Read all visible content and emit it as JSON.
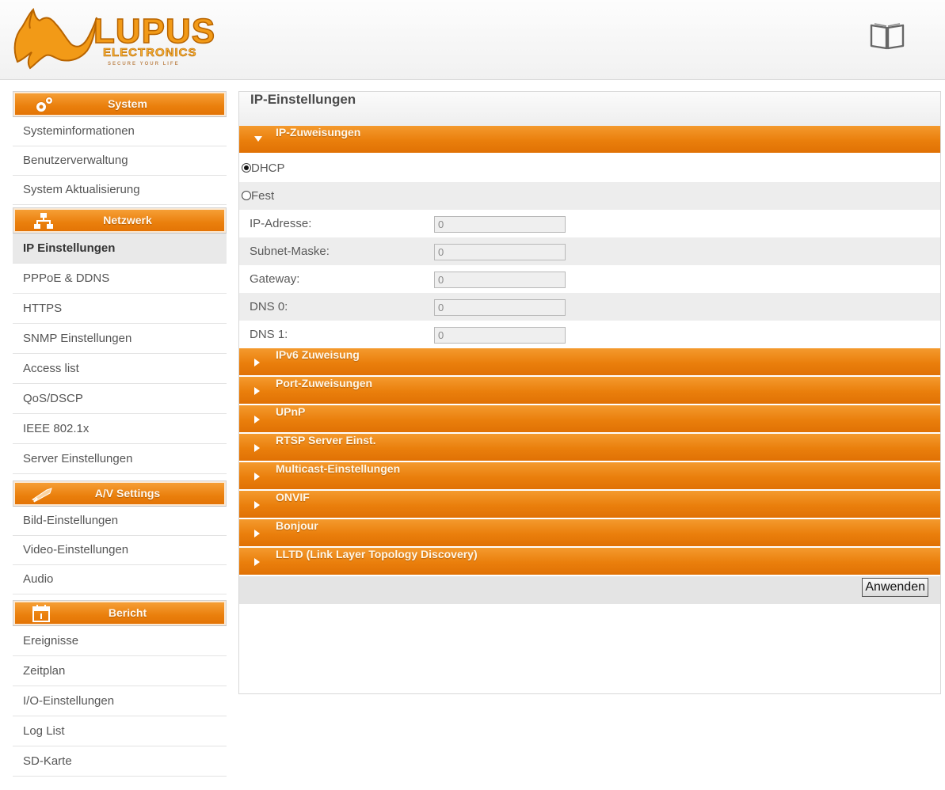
{
  "header": {
    "logo_text": "LUPUS",
    "logo_sub": "ELECTRONICS",
    "logo_tag": "SECURE YOUR LIFE",
    "manual_icon": "book-icon"
  },
  "colors": {
    "accent": "#ea7f0c",
    "accent_light": "#f7a23a",
    "active_item": "#e9e9e9"
  },
  "sidebar": {
    "system": {
      "label": "System",
      "icon": "gear-icon",
      "items": [
        "Systeminformationen",
        "Benutzerverwaltung",
        "System Aktualisierung"
      ]
    },
    "netzwerk": {
      "label": "Netzwerk",
      "icon": "network-icon",
      "items": [
        "IP Einstellungen",
        "PPPoE & DDNS",
        "HTTPS",
        "SNMP Einstellungen",
        "Access list",
        "QoS/DSCP",
        "IEEE 802.1x",
        "Server Einstellungen"
      ],
      "active": "IP Einstellungen"
    },
    "av": {
      "label": "A/V Settings",
      "icon": "camera-icon",
      "items": [
        "Bild-Einstellungen",
        "Video-Einstellungen",
        "Audio"
      ]
    },
    "bericht": {
      "label": "Bericht",
      "icon": "calendar-icon",
      "items": [
        "Ereignisse",
        "Zeitplan",
        "I/O-Einstellungen",
        "Log List",
        "SD-Karte"
      ]
    }
  },
  "main": {
    "title": "IP-Einstellungen",
    "ip_section": {
      "label": "IP-Zuweisungen",
      "dhcp_label": "DHCP",
      "fest_label": "Fest",
      "selected": "DHCP",
      "fields": [
        {
          "label": "IP-Adresse:",
          "value": "0"
        },
        {
          "label": "Subnet-Maske:",
          "value": "0"
        },
        {
          "label": "Gateway:",
          "value": "0"
        },
        {
          "label": "DNS 0:",
          "value": "0"
        },
        {
          "label": "DNS 1:",
          "value": "0"
        }
      ]
    },
    "sections": [
      "IPv6 Zuweisung",
      "Port-Zuweisungen",
      "UPnP",
      "RTSP Server Einst.",
      "Multicast-Einstellungen",
      "ONVIF",
      "Bonjour",
      "LLTD (Link Layer Topology Discovery)"
    ],
    "apply_label": "Anwenden"
  }
}
